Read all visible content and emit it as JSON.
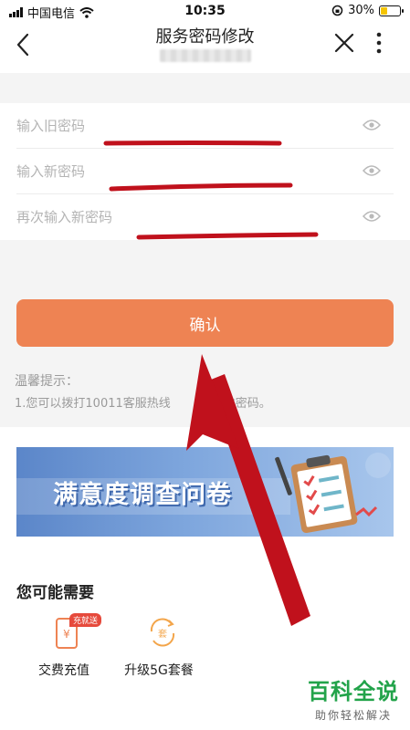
{
  "status_bar": {
    "carrier": "中国电信",
    "time": "10:35",
    "battery_text": "30%",
    "battery_level": 0.3
  },
  "header": {
    "title": "服务密码修改",
    "back_icon": "chevron-left-icon",
    "close_icon": "close-icon",
    "more_icon": "more-vertical-icon"
  },
  "form": {
    "old_password_placeholder": "输入旧密码",
    "new_password_placeholder": "输入新密码",
    "confirm_password_placeholder": "再次输入新密码",
    "eye_icon": "eye-icon"
  },
  "confirm_button": {
    "label": "确认",
    "color": "#ee8353"
  },
  "tips": {
    "title": "温馨提示：",
    "line1": "1.您可以拨打10011客服热线",
    "line1_tail": "改密码。"
  },
  "banner": {
    "text": "满意度调查问卷"
  },
  "recommend": {
    "title": "您可能需要",
    "items": [
      {
        "label": "交费充值",
        "badge": "充就送",
        "icon": "phone-recharge-icon"
      },
      {
        "label": "升级5G套餐",
        "icon": "package-upgrade-icon"
      }
    ]
  },
  "watermark": {
    "main": "百科全说",
    "sub": "助你轻松解决"
  },
  "colors": {
    "accent": "#ee8353",
    "annotation": "#c0111c",
    "background_gray": "#f4f4f4"
  }
}
